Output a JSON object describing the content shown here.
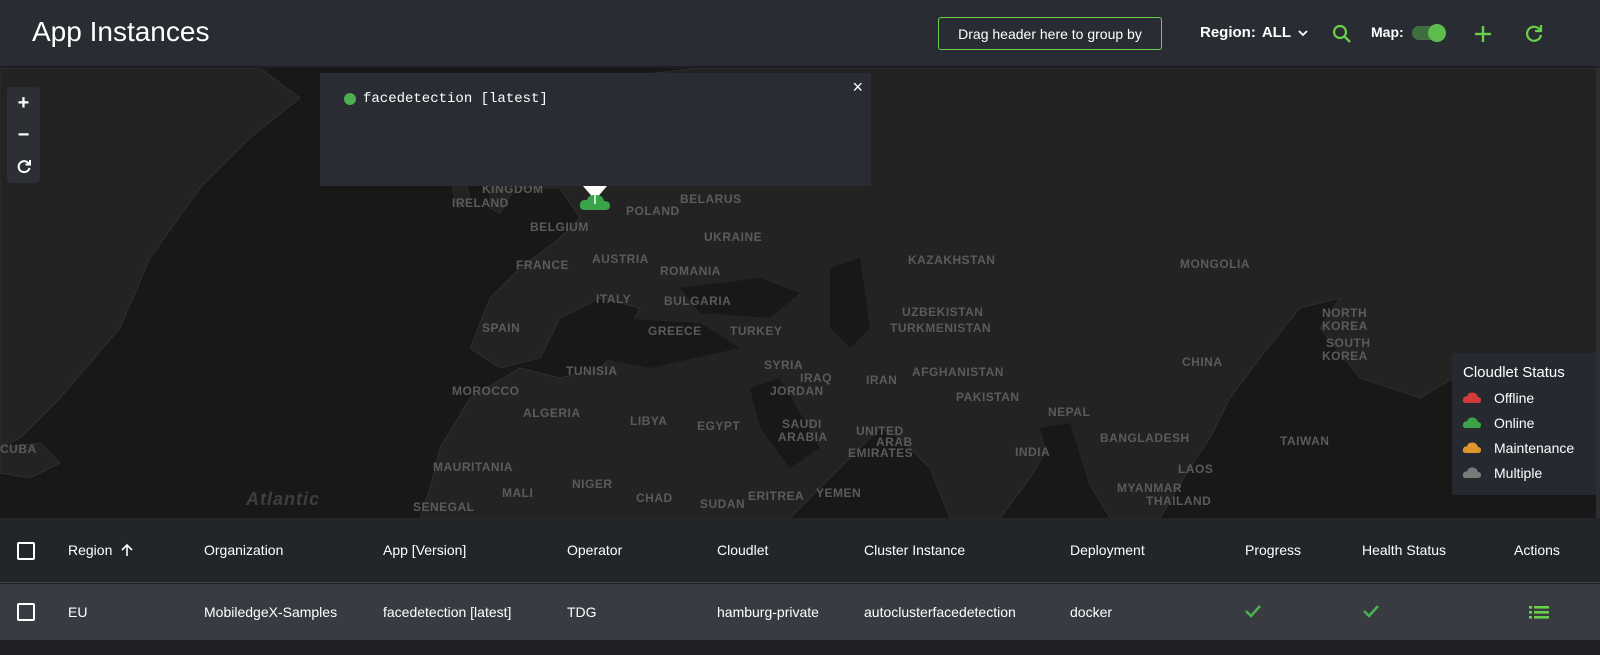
{
  "header": {
    "title": "App Instances",
    "group_by": "Drag header here to group by",
    "region_label": "Region:",
    "region_value": "ALL",
    "map_label": "Map:",
    "map_enabled": true,
    "accent": "#6ad04a"
  },
  "map": {
    "zoom_in": "+",
    "zoom_out": "−",
    "popup": {
      "text": "facedetection [latest]",
      "close": "×"
    },
    "countries": [
      "IRELAND",
      "KINGDOM",
      "BELGIUM",
      "FRANCE",
      "POLAND",
      "BELARUS",
      "UKRAINE",
      "AUSTRIA",
      "ROMANIA",
      "ITALY",
      "BULGARIA",
      "SPAIN",
      "GREECE",
      "TURKEY",
      "KAZAKHSTAN",
      "MONGOLIA",
      "UZBEKISTAN",
      "TURKMENISTAN",
      "SYRIA",
      "IRAQ",
      "IRAN",
      "AFGHANISTAN",
      "PAKISTAN",
      "CHINA",
      "NORTH",
      "KOREA",
      "SOUTH",
      "KOREA",
      "JORDAN",
      "TUNISIA",
      "MOROCCO",
      "ALGERIA",
      "LIBYA",
      "EGYPT",
      "SAUDI",
      "ARABIA",
      "UNITED",
      "ARAB",
      "EMIRATES",
      "NEPAL",
      "INDIA",
      "BANGLADESH",
      "TAIWAN",
      "LAOS",
      "MYANMAR",
      "THAILAND",
      "MAURITANIA",
      "MALI",
      "NIGER",
      "CHAD",
      "SUDAN",
      "ERITREA",
      "YEMEN",
      "SENEGAL",
      "CUBA"
    ],
    "ocean": "Atlantic",
    "legend": {
      "title": "Cloudlet Status",
      "items": [
        {
          "label": "Offline",
          "color": "#d33a3a"
        },
        {
          "label": "Online",
          "color": "#3aa548"
        },
        {
          "label": "Maintenance",
          "color": "#e0962c"
        },
        {
          "label": "Multiple",
          "color": "#7a7a7a"
        }
      ]
    }
  },
  "table": {
    "columns": [
      "Region",
      "Organization",
      "App [Version]",
      "Operator",
      "Cloudlet",
      "Cluster Instance",
      "Deployment",
      "Progress",
      "Health Status",
      "Actions"
    ],
    "rows": [
      {
        "region": "EU",
        "organization": "MobiledgeX-Samples",
        "app": "facedetection [latest]",
        "operator": "TDG",
        "cloudlet": "hamburg-private",
        "cluster": "autoclusterfacedetection",
        "deployment": "docker"
      }
    ]
  }
}
